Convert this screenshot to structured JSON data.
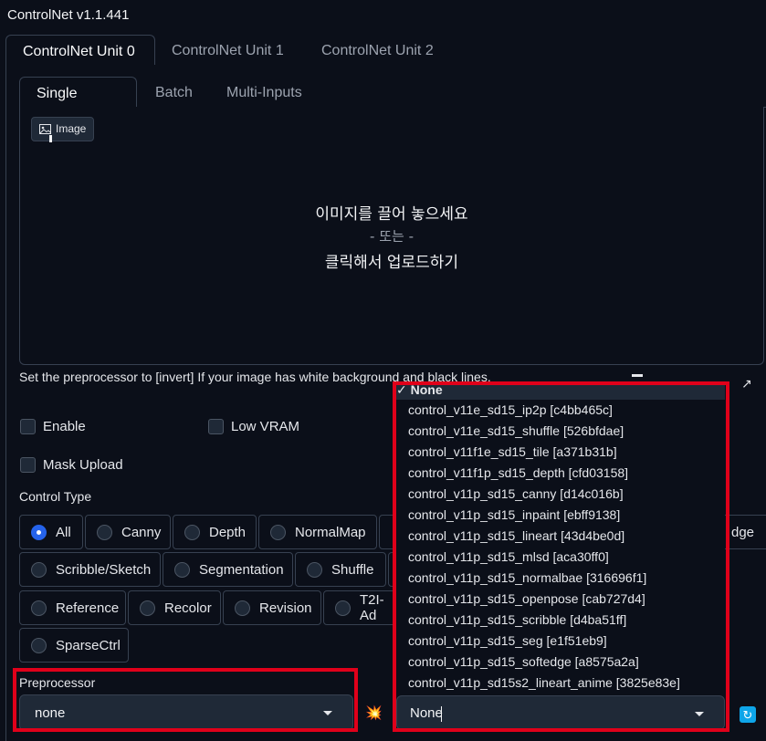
{
  "title": "ControlNet v1.1.441",
  "unit_tabs": [
    "ControlNet Unit 0",
    "ControlNet Unit 1",
    "ControlNet Unit 2"
  ],
  "input_tabs": [
    "Single Image",
    "Batch",
    "Multi-Inputs"
  ],
  "image_label": "Image",
  "dropzone": {
    "line1": "이미지를 끌어 놓으세요",
    "line2": "- 또는 -",
    "line3": "클릭해서 업로드하기"
  },
  "hint": "Set the preprocessor to [invert] If your image has white background and black lines.",
  "checkboxes": {
    "enable": "Enable",
    "low_vram": "Low VRAM",
    "mask_upload": "Mask Upload"
  },
  "control_type_label": "Control Type",
  "control_types": {
    "all": "All",
    "canny": "Canny",
    "depth": "Depth",
    "normalmap": "NormalMap",
    "softedge_tail": "dge",
    "scribble": "Scribble/Sketch",
    "segmentation": "Segmentation",
    "shuffle": "Shuffle",
    "reference": "Reference",
    "recolor": "Recolor",
    "revision": "Revision",
    "t2i": "T2I-Ad",
    "sparsectrl": "SparseCtrl"
  },
  "preprocessor": {
    "label": "Preprocessor",
    "value": "none"
  },
  "model": {
    "value": "None",
    "options": [
      "None",
      "control_v11e_sd15_ip2p [c4bb465c]",
      "control_v11e_sd15_shuffle [526bfdae]",
      "control_v11f1e_sd15_tile [a371b31b]",
      "control_v11f1p_sd15_depth [cfd03158]",
      "control_v11p_sd15_canny [d14c016b]",
      "control_v11p_sd15_inpaint [ebff9138]",
      "control_v11p_sd15_lineart [43d4be0d]",
      "control_v11p_sd15_mlsd [aca30ff0]",
      "control_v11p_sd15_normalbae [316696f1]",
      "control_v11p_sd15_openpose [cab727d4]",
      "control_v11p_sd15_scribble [d4ba51ff]",
      "control_v11p_sd15_seg [e1f51eb9]",
      "control_v11p_sd15_softedge [a8575a2a]",
      "control_v11p_sd15s2_lineart_anime [3825e83e]"
    ]
  },
  "icons": {
    "selected_check": "✓",
    "explosion": "💥",
    "refresh": "↻"
  },
  "colors": {
    "accent": "#2563eb",
    "highlight_box": "#e0001a",
    "refresh_button": "#0ea5e9"
  }
}
